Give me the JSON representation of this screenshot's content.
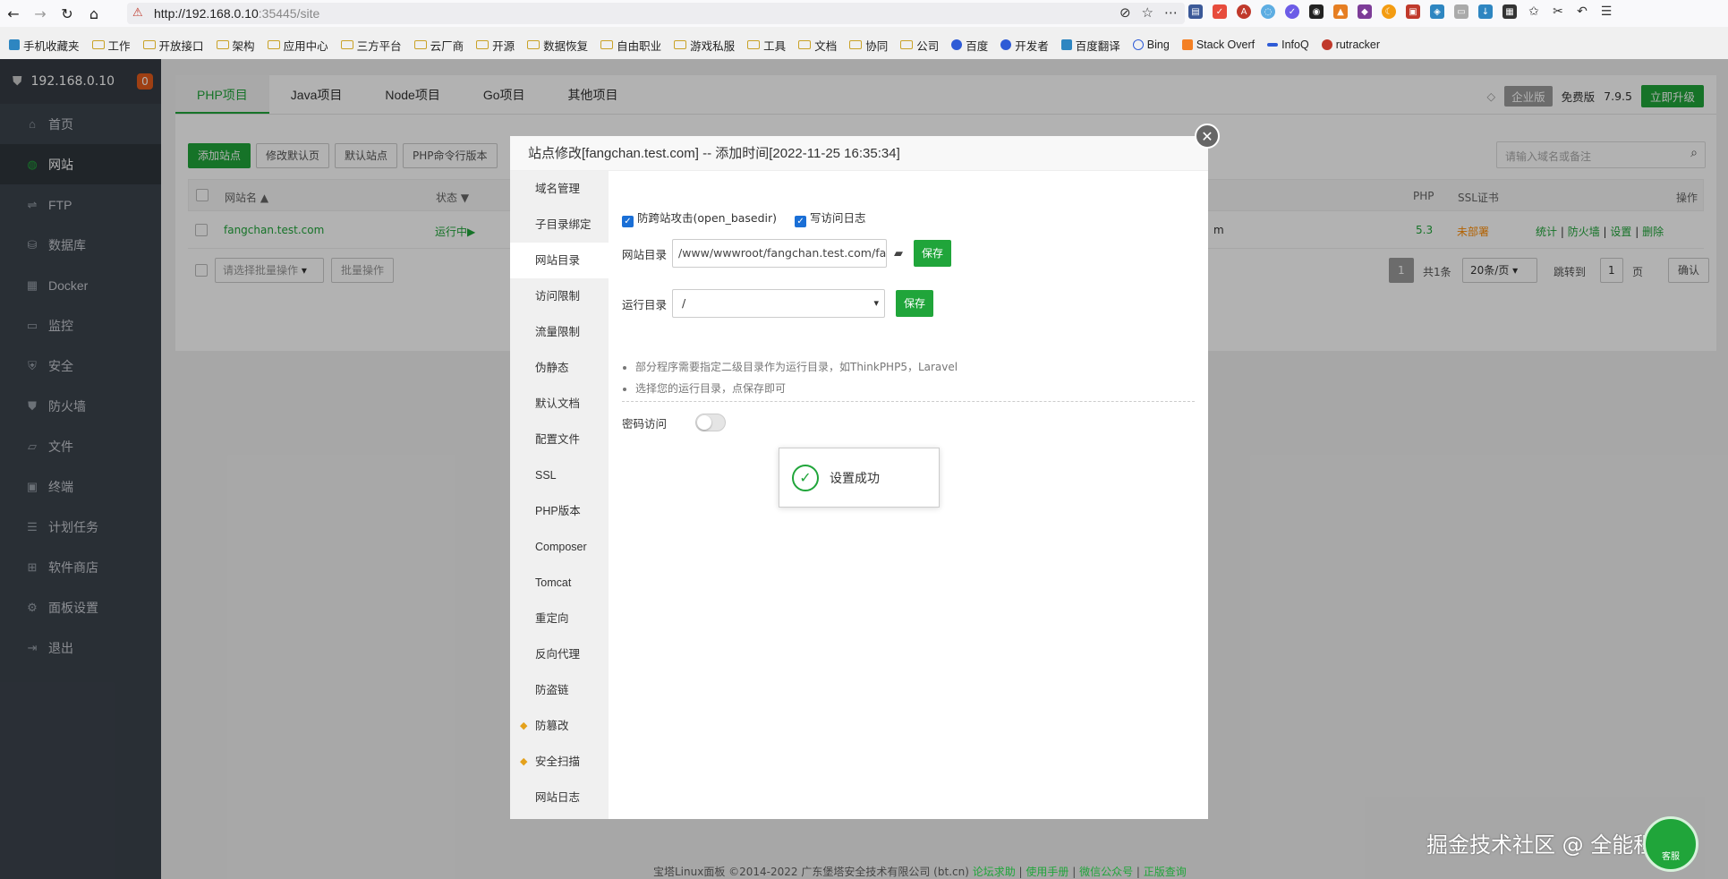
{
  "browser": {
    "url_host": "http://192.168.0.10",
    "url_rest": ":35445/site",
    "bookmarks": [
      "手机收藏夹",
      "工作",
      "开放接口",
      "架构",
      "应用中心",
      "三方平台",
      "云厂商",
      "开源",
      "数据恢复",
      "自由职业",
      "游戏私服",
      "工具",
      "文档",
      "协同",
      "公司",
      "百度",
      "开发者",
      "百度翻译",
      "Bing",
      "Stack Overf",
      "InfoQ",
      "rutracker"
    ]
  },
  "sidebar": {
    "ip": "192.168.0.10",
    "badge": "0",
    "items": [
      {
        "label": "首页",
        "icon": "home-icon"
      },
      {
        "label": "网站",
        "icon": "globe-icon"
      },
      {
        "label": "FTP",
        "icon": "ftp-icon"
      },
      {
        "label": "数据库",
        "icon": "database-icon"
      },
      {
        "label": "Docker",
        "icon": "docker-icon"
      },
      {
        "label": "监控",
        "icon": "monitor-icon"
      },
      {
        "label": "安全",
        "icon": "shield-icon"
      },
      {
        "label": "防火墙",
        "icon": "firewall-icon"
      },
      {
        "label": "文件",
        "icon": "folder-icon"
      },
      {
        "label": "终端",
        "icon": "terminal-icon"
      },
      {
        "label": "计划任务",
        "icon": "clock-icon"
      },
      {
        "label": "软件商店",
        "icon": "grid-icon"
      },
      {
        "label": "面板设置",
        "icon": "gear-icon"
      },
      {
        "label": "退出",
        "icon": "logout-icon"
      }
    ]
  },
  "tabs": [
    "PHP项目",
    "Java项目",
    "Node项目",
    "Go项目",
    "其他项目"
  ],
  "edition": {
    "enterprise": "企业版",
    "free": "免费版",
    "version": "7.9.5",
    "upgrade": "立即升级"
  },
  "toolbar": [
    "添加站点",
    "修改默认页",
    "默认站点",
    "PHP命令行版本"
  ],
  "search": {
    "placeholder": "请输入域名或备注"
  },
  "table": {
    "headers": {
      "name": "网站名 ▲",
      "status": "状态 ▼",
      "php": "PHP",
      "ssl": "SSL证书",
      "ops": "操作"
    },
    "row": {
      "name": "fangchan.test.com",
      "status": "运行中▶",
      "remark": "m",
      "php": "5.3",
      "ssl": "未部署",
      "ops": [
        "统计",
        "防火墙",
        "设置",
        "删除"
      ]
    }
  },
  "bulk": {
    "select": "请选择批量操作",
    "apply": "批量操作"
  },
  "pager": {
    "page": "1",
    "total": "共1条",
    "per_page": "20条/页",
    "jump": "跳转到",
    "page_input": "1",
    "unit": "页",
    "confirm": "确认"
  },
  "modal": {
    "title": "站点修改[fangchan.test.com] -- 添加时间[2022-11-25 16:35:34]",
    "menu": [
      "域名管理",
      "子目录绑定",
      "网站目录",
      "访问限制",
      "流量限制",
      "伪静态",
      "默认文档",
      "配置文件",
      "SSL",
      "PHP版本",
      "Composer",
      "Tomcat",
      "重定向",
      "反向代理",
      "防盗链",
      "防篡改",
      "安全扫描",
      "网站日志"
    ],
    "chk1": "防跨站攻击(open_basedir)",
    "chk2": "写访问日志",
    "dir_label": "网站目录",
    "dir_value": "/www/wwwroot/fangchan.test.com/fangchan",
    "run_label": "运行目录",
    "run_value": "/",
    "save": "保存",
    "tip1": "部分程序需要指定二级目录作为运行目录，如ThinkPHP5，Laravel",
    "tip2": "选择您的运行目录，点保存即可",
    "pw_label": "密码访问",
    "toast": "设置成功"
  },
  "footer": {
    "text": "宝塔Linux面板 ©2014-2022 广东堡塔安全技术有限公司 (bt.cn)",
    "links": [
      "论坛求助",
      "使用手册",
      "微信公众号",
      "正版查询"
    ]
  },
  "watermark": "掘金技术社区 @ 全能程序员",
  "help_ball": "客服"
}
